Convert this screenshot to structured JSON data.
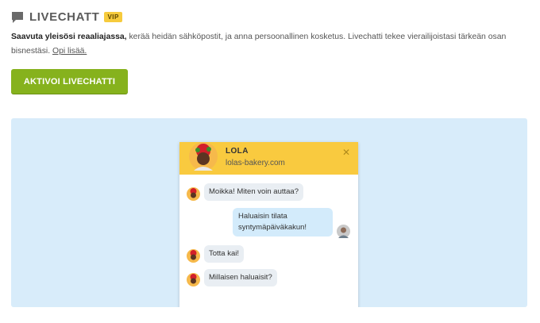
{
  "header": {
    "title": "LIVECHATT",
    "badge": "VIP",
    "icon": "chat-bubble-icon"
  },
  "description": {
    "bold": "Saavuta yleisösi reaaliajassa,",
    "text": " kerää heidän sähköpostit, ja anna persoonallinen kosketus. Livechatti tekee vierailijoistasi tärkeän osan bisnestäsi.",
    "link": "Opi lisää."
  },
  "cta": {
    "label": "AKTIVOI LIVECHATTI"
  },
  "widget": {
    "agent_name": "LOLA",
    "site": "lolas-bakery.com",
    "close_icon": "close-icon",
    "header_color": "#f9ca3f",
    "messages": [
      {
        "from": "agent",
        "text": "Moikka! Miten voin auttaa?"
      },
      {
        "from": "visitor",
        "text": "Haluaisin tilata syntymäpäiväkakun!"
      },
      {
        "from": "agent",
        "text": "Totta kai!"
      },
      {
        "from": "agent",
        "text": "Millaisen haluaisit?"
      }
    ]
  },
  "colors": {
    "accent_green": "#86b21d",
    "preview_bg": "#d8ecfa",
    "vip_badge": "#f6cb3d"
  }
}
